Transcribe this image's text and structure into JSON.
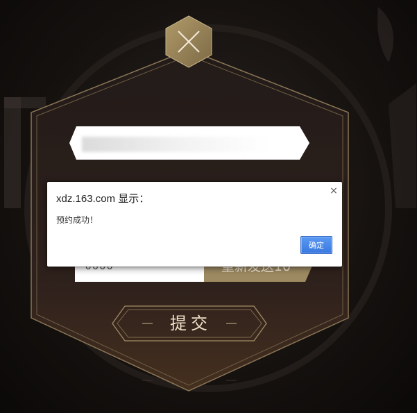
{
  "form": {
    "code_value": "0000",
    "resend_label": "重新发送10",
    "submit_label": "提交"
  },
  "dialog": {
    "title": "xdz.163.com 显示：",
    "message": "预约成功！",
    "close_glyph": "×",
    "ok_label": "确定"
  },
  "colors": {
    "gold": "#9a8458",
    "panel_top": "#221b19",
    "panel_bottom": "#3f2a20",
    "ok_button": "#3a78df"
  },
  "icons": {
    "top_close": "close-icon",
    "dialog_close": "close-icon"
  }
}
